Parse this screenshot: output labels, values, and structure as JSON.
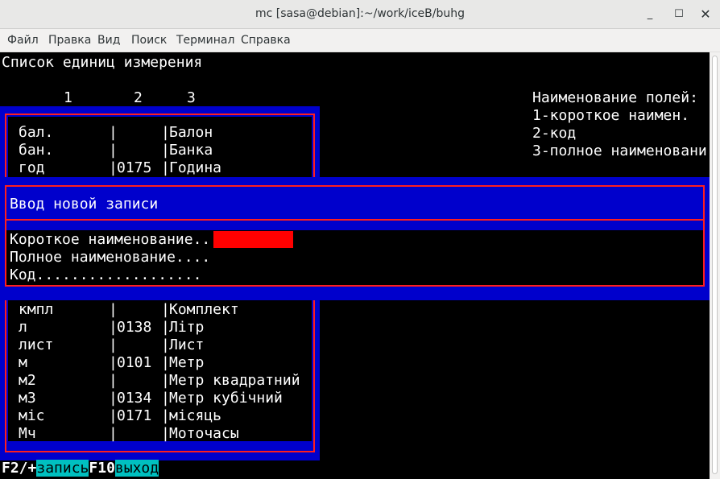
{
  "window": {
    "title": "mc [sasa@debian]:~/work/iceB/buhg",
    "minimize_icon": "minimize-icon",
    "maximize_icon": "maximize-icon",
    "close_icon": "close-icon"
  },
  "menu": [
    "Файл",
    "Правка",
    "Вид",
    "Поиск",
    "Терминал",
    "Справка"
  ],
  "screen": {
    "heading": "Список единиц измерения",
    "column_numbers": [
      "1",
      "2",
      "3"
    ],
    "legend": [
      "Наименование полей:",
      "1-короткое наимен.",
      "2-код",
      "3-полное наименовани"
    ]
  },
  "rows_top": [
    {
      "short": "бал.",
      "code": "",
      "full": "Балон"
    },
    {
      "short": "бан.",
      "code": "",
      "full": "Банка"
    },
    {
      "short": "год",
      "code": "0175",
      "full": "Година"
    }
  ],
  "rows_bottom": [
    {
      "short": "кмпл",
      "code": "",
      "full": "Комплект"
    },
    {
      "short": "л",
      "code": "0138",
      "full": "Літр"
    },
    {
      "short": "лист",
      "code": "",
      "full": "Лист"
    },
    {
      "short": "м",
      "code": "0101",
      "full": "Метр"
    },
    {
      "short": "м2",
      "code": "",
      "full": "Метр квадратний"
    },
    {
      "short": "м3",
      "code": "0134",
      "full": "Метр кубічний"
    },
    {
      "short": "міс",
      "code": "0171",
      "full": "місяць"
    },
    {
      "short": "Мч",
      "code": "",
      "full": "Моточасы"
    }
  ],
  "dialog": {
    "title": "Ввод новой записи",
    "field_short": "Короткое наименование..",
    "field_full": "Полное наименование....",
    "field_code": "Код...................",
    "short_value": "",
    "full_value": "",
    "code_value": ""
  },
  "hotkeys": {
    "k1": "F2/+",
    "a1": "запись",
    "k2": "F10",
    "a2": "выход"
  },
  "colors": {
    "accent_blue": "#0000cc",
    "frame_red": "#ff1e1e",
    "hotkey_cyan": "#00c0c0"
  }
}
